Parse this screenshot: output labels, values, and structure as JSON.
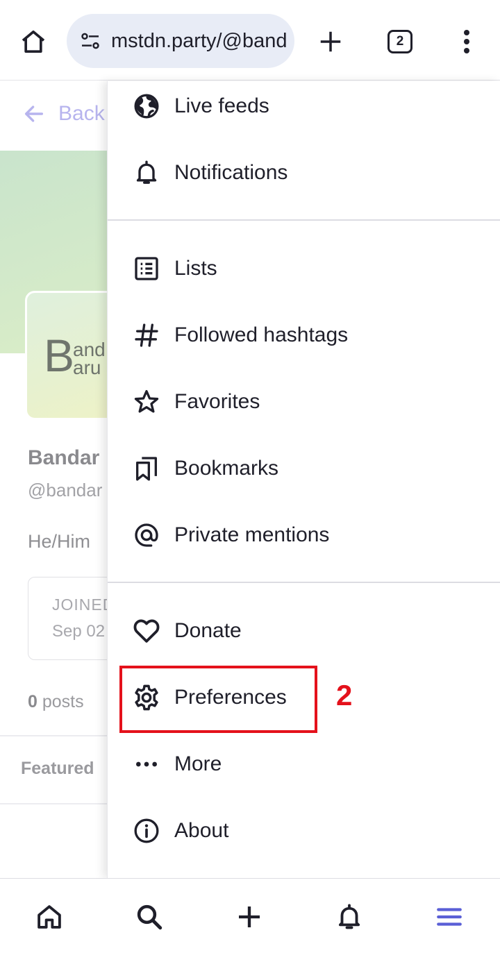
{
  "browser": {
    "url": "mstdn.party/@band",
    "tab_count": "2",
    "icons": [
      "home-icon",
      "site-settings-icon",
      "new-tab-icon",
      "tab-switcher-icon",
      "overflow-menu-icon"
    ]
  },
  "background_page": {
    "back_label": "Back",
    "avatar_text": {
      "initial": "B",
      "line1": "and",
      "line2": "aru"
    },
    "profile_name": "Bandar",
    "profile_handle": "@bandar",
    "bio": "He/Him",
    "joined_label": "JOINED",
    "joined_date": "Sep 02",
    "posts_count": "0",
    "posts_label": "posts",
    "featured_tab": "Featured"
  },
  "menu": {
    "items": [
      {
        "label": "Live feeds",
        "icon": "globe-icon"
      },
      {
        "label": "Notifications",
        "icon": "bell-icon"
      },
      {
        "label": "Lists",
        "icon": "list-icon"
      },
      {
        "label": "Followed hashtags",
        "icon": "hashtag-icon"
      },
      {
        "label": "Favorites",
        "icon": "star-icon"
      },
      {
        "label": "Bookmarks",
        "icon": "bookmarks-icon"
      },
      {
        "label": "Private mentions",
        "icon": "at-icon"
      },
      {
        "label": "Donate",
        "icon": "heart-icon"
      },
      {
        "label": "Preferences",
        "icon": "gear-icon"
      },
      {
        "label": "More",
        "icon": "more-icon"
      },
      {
        "label": "About",
        "icon": "info-icon"
      }
    ]
  },
  "annotation": {
    "highlighted_item": "Preferences",
    "number": "2",
    "color": "#e4111b"
  },
  "bottom_nav": {
    "icons": [
      "home-icon",
      "search-icon",
      "compose-icon",
      "notifications-icon",
      "menu-icon"
    ],
    "active": "menu-icon",
    "accent": "#5a5fd6"
  }
}
